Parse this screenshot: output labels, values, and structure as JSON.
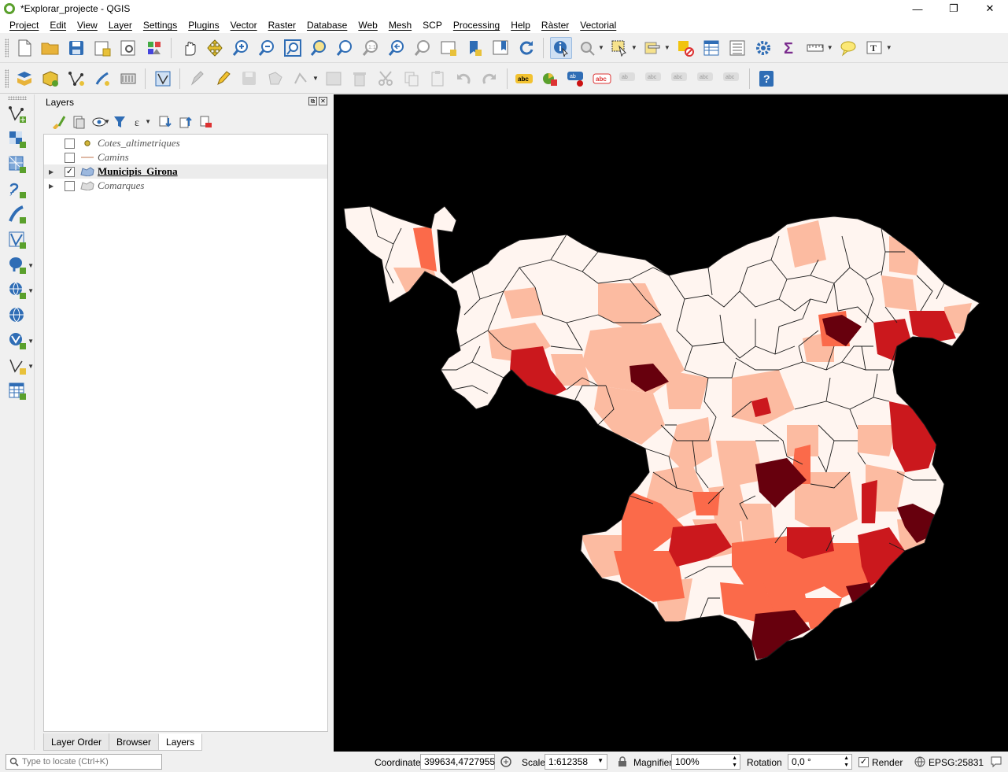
{
  "window": {
    "title": "*Explorar_projecte - QGIS",
    "controls": {
      "minimize": "—",
      "restore": "❐",
      "close": "✕"
    }
  },
  "menu": [
    "Project",
    "Edit",
    "View",
    "Layer",
    "Settings",
    "Plugins",
    "Vector",
    "Raster",
    "Database",
    "Web",
    "Mesh",
    "SCP",
    "Processing",
    "Help",
    "Ràster",
    "Vectorial"
  ],
  "layers_panel": {
    "title": "Layers",
    "layers": [
      {
        "name": "Cotes_altimetriques",
        "checked": false,
        "expandable": false,
        "symbol": "point"
      },
      {
        "name": "Camins",
        "checked": false,
        "expandable": false,
        "symbol": "line"
      },
      {
        "name": "Municipis_Girona",
        "checked": true,
        "expandable": true,
        "symbol": "polygon",
        "selected": true
      },
      {
        "name": "Comarques",
        "checked": false,
        "expandable": true,
        "symbol": "polygon"
      }
    ],
    "tabs": [
      "Layer Order",
      "Browser",
      "Layers"
    ],
    "active_tab": "Layers"
  },
  "statusbar": {
    "locate_placeholder": "Type to locate (Ctrl+K)",
    "coordinate_label": "Coordinate",
    "coordinate_value": "399634,4727955",
    "scale_label": "Scale",
    "scale_value": "1:612358",
    "magnifier_label": "Magnifier",
    "magnifier_value": "100%",
    "rotation_label": "Rotation",
    "rotation_value": "0,0 °",
    "render_label": "Render",
    "render_checked": true,
    "crs": "EPSG:25831"
  },
  "map": {
    "background": "#000000",
    "class_colors": [
      "#fff5f0",
      "#fcbba1",
      "#fb6a4a",
      "#cb181d",
      "#67000d"
    ]
  }
}
